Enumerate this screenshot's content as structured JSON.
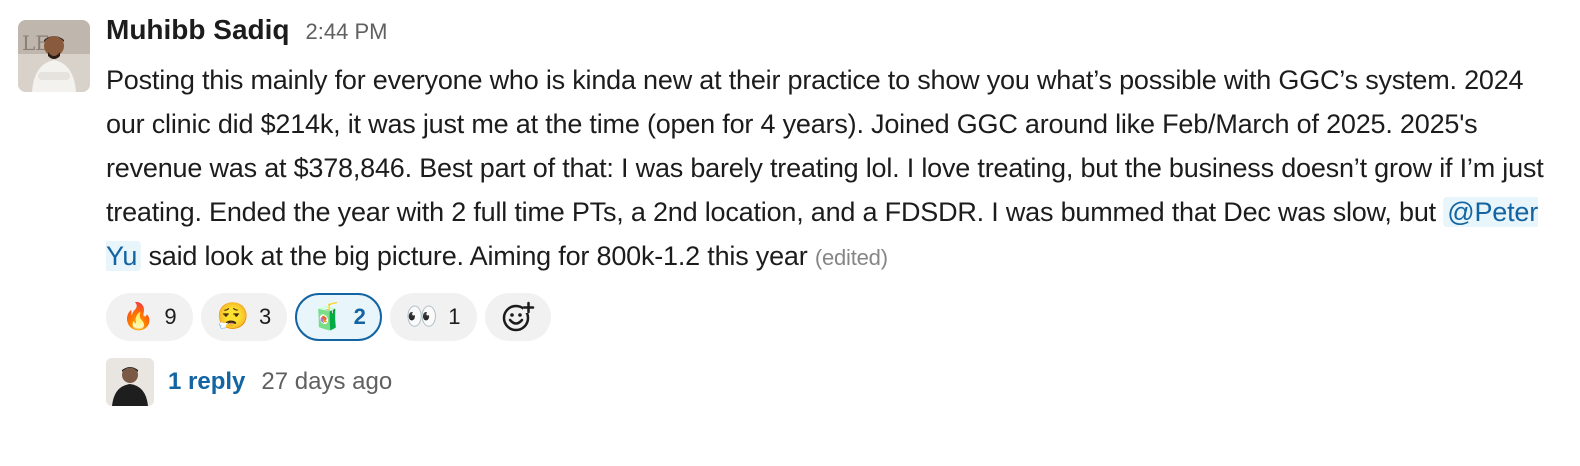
{
  "message": {
    "author": "Muhibb Sadiq",
    "time": "2:44 PM",
    "text_before_mention": "Posting this mainly for everyone who is kinda new at their practice to show you what’s possible with GGC’s system. 2024 our clinic did $214k, it was just me at the time (open for 4 years). Joined GGC around like Feb/March of 2025. 2025's revenue was at $378,846. Best part of that: I was barely treating lol. I love treating, but the business doesn’t grow if I’m just treating. Ended the year with 2 full time PTs, a 2nd location, and a FDSDR. I was bummed that Dec was slow, but",
    "mention": "@Peter Yu",
    "text_after_mention": "said look at the big picture. Aiming for 800k-1.2 this year",
    "edited_label": "(edited)"
  },
  "reactions": [
    {
      "emoji": "🔥",
      "icon": "fire-icon",
      "count": "9",
      "active": false
    },
    {
      "emoji": "😮‍💨",
      "icon": "exhale-face-icon",
      "count": "3",
      "active": false
    },
    {
      "emoji": "🧃",
      "icon": "juice-box-icon",
      "count": "2",
      "active": true
    },
    {
      "emoji": "👀",
      "icon": "eyes-icon",
      "count": "1",
      "active": false
    }
  ],
  "add_reaction_icon": "add-reaction-icon",
  "thread": {
    "reply_count": "1 reply",
    "last_reply": "27 days ago"
  },
  "colors": {
    "link": "#1264a3",
    "mention_bg": "#e8f5fa",
    "reaction_bg": "#f1f1f1",
    "text": "#1d1c1d",
    "muted": "#616061"
  }
}
